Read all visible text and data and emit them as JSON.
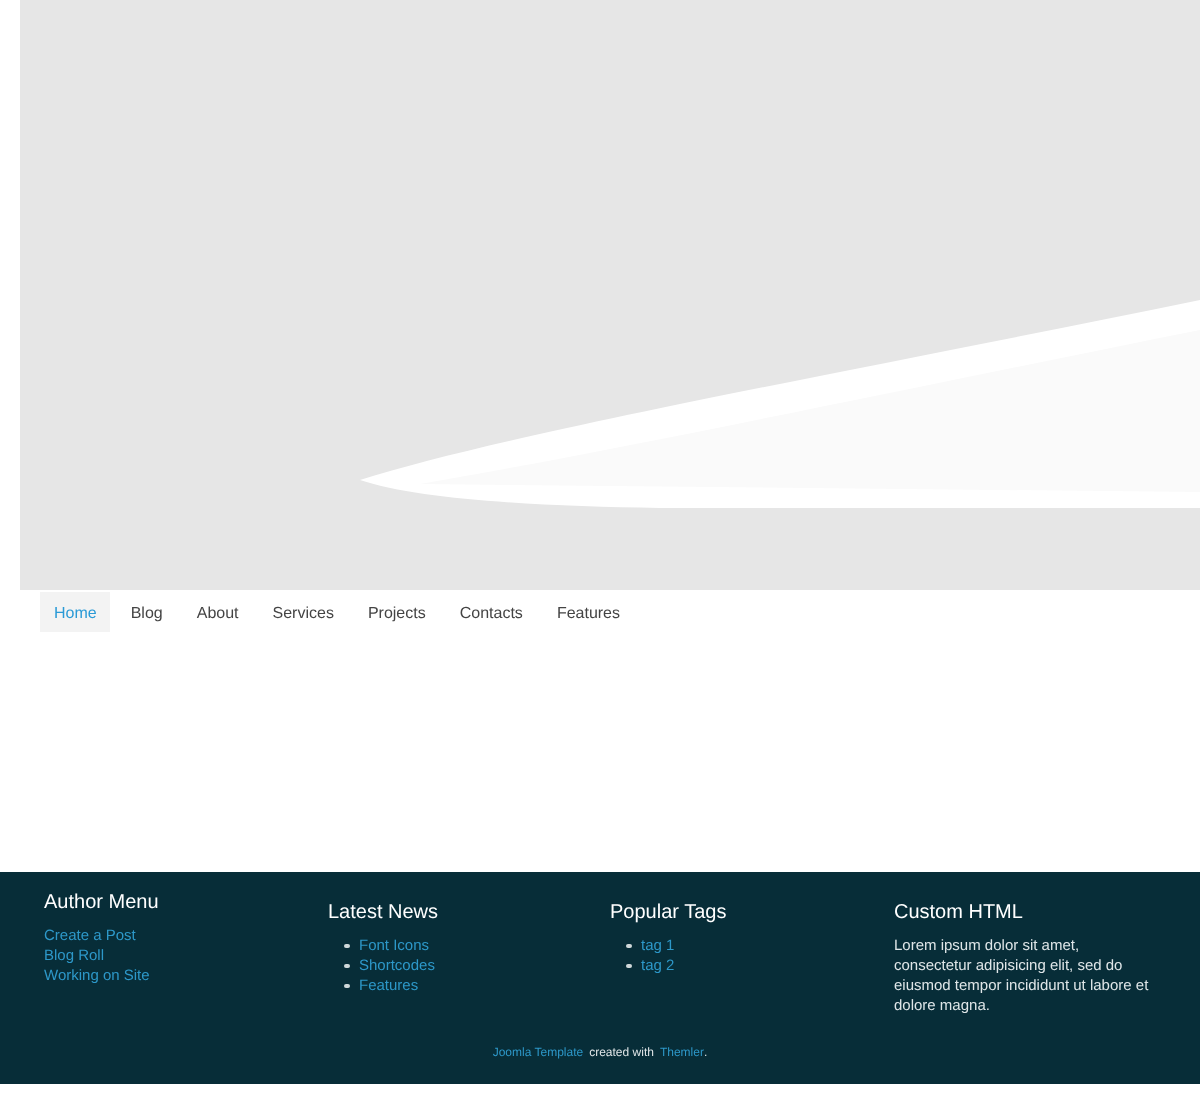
{
  "nav": [
    {
      "label": "Home",
      "selected": true
    },
    {
      "label": "Blog",
      "selected": false
    },
    {
      "label": "About",
      "selected": false
    },
    {
      "label": "Services",
      "selected": false
    },
    {
      "label": "Projects",
      "selected": false
    },
    {
      "label": "Contacts",
      "selected": false
    },
    {
      "label": "Features",
      "selected": false
    }
  ],
  "footer": {
    "columns": [
      {
        "title": "Author Menu",
        "kind": "links",
        "items": [
          "Create a Post",
          "Blog Roll",
          "Working on Site"
        ]
      },
      {
        "title": "Latest News",
        "kind": "bullets",
        "items": [
          "Font Icons",
          "Shortcodes",
          "Features"
        ]
      },
      {
        "title": "Popular Tags",
        "kind": "bullets",
        "items": [
          "tag 1",
          "tag 2"
        ]
      },
      {
        "title": "Custom HTML",
        "kind": "text",
        "text": "Lorem ipsum dolor sit amet, consectetur adipisicing elit, sed do eiusmod tempor incididunt ut labore et dolore magna."
      }
    ],
    "credits": {
      "link_1": "Joomla Template",
      "text": "created with",
      "link_2": "Themler",
      "end": "."
    }
  }
}
